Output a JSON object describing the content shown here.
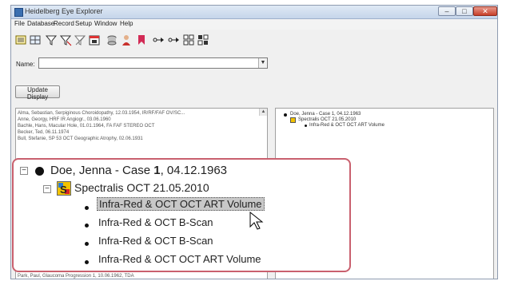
{
  "window": {
    "title": "Heidelberg Eye Explorer",
    "controls": {
      "minimize": "–",
      "maximize": "□",
      "close": "✕"
    }
  },
  "menu": [
    "File",
    "Database",
    "Record",
    "Setup",
    "Window",
    "Help"
  ],
  "toolbar": {
    "icons": [
      "list-view-icon",
      "grid-view-icon",
      "filter-icon",
      "filter-remove-icon",
      "filter-off-icon",
      "calendar-icon",
      "database-icon",
      "patient-icon",
      "bookmark-icon",
      "link-icon",
      "link-forward-icon",
      "expand-all-icon",
      "collapse-all-icon"
    ]
  },
  "search": {
    "label": "Name:",
    "value": ""
  },
  "update_button": "Update Display",
  "left_list": [
    "Alma, Sebastian, Serpiginous Choroidopathy, 12.03.1954, IR/RF/FAF OV/SC...",
    "Anne, Georgy, HRF IR Angiogr., 03.06.1960",
    "Bachle, Hans, Macular Hole, 01.01.1964, FA FAF STEREO OCT",
    "Becker, Ted, 06.11.1974",
    "Bull, Stefanie, SP 53 OCT Geographic Atrophy, 02.06.1931"
  ],
  "left_bottom": "Park, Paul, Glaucoma Progression 1, 10.06.1962, TDA",
  "right_tree": {
    "patient": "Doe, Jenna - Case 1, 04.12.1963",
    "study": "Spectralis OCT 21.05.2010",
    "series": [
      "Infra-Red & OCT OCT ART Volume"
    ]
  },
  "zoom": {
    "patient_name": "Doe,  Jenna - Case ",
    "case_number": "1",
    "patient_date": ", 04.12.1963",
    "study": "Spectralis OCT 21.05.2010",
    "series": [
      "Infra-Red & OCT OCT ART Volume",
      "Infra-Red & OCT B-Scan",
      "Infra-Red & OCT B-Scan",
      "Infra-Red & OCT OCT ART Volume"
    ]
  },
  "colors": {
    "callout_border": "#c9606e",
    "selection": "#c8c8c8",
    "close_button": "#c8402a"
  }
}
